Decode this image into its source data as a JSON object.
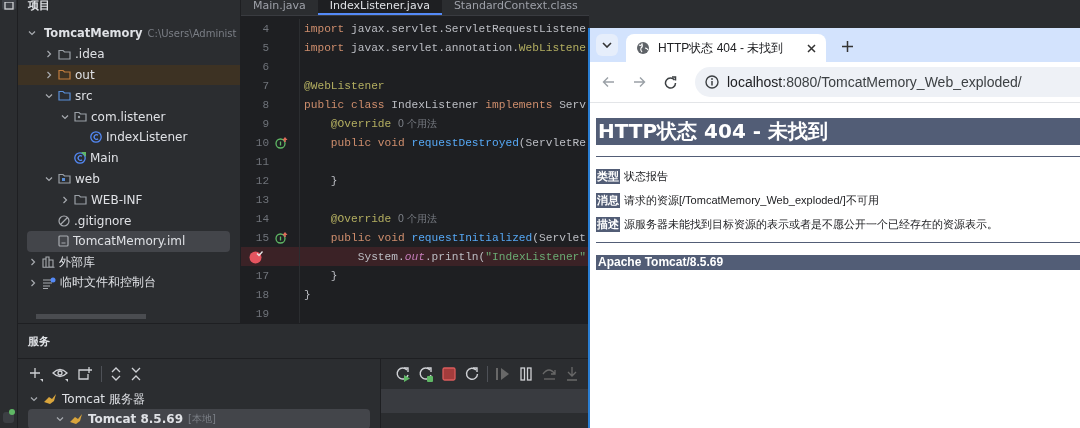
{
  "project_panel": {
    "title": "项目",
    "tree": [
      {
        "name": "TomcatMemory",
        "path": "C:\\Users\\Administ",
        "kind": "module",
        "expanded": true,
        "selected": false,
        "children": [
          {
            "name": ".idea",
            "kind": "folder",
            "expanded": false,
            "selected": false
          },
          {
            "name": "out",
            "kind": "excluded-folder",
            "expanded": false,
            "selected": false
          },
          {
            "name": "src",
            "kind": "source-folder",
            "expanded": true,
            "selected": false,
            "children": [
              {
                "name": "com.listener",
                "kind": "package",
                "expanded": true,
                "selected": false,
                "children": [
                  {
                    "name": "IndexListener",
                    "kind": "class",
                    "selected": false
                  }
                ]
              },
              {
                "name": "Main",
                "kind": "main-class",
                "selected": false
              }
            ]
          },
          {
            "name": "web",
            "kind": "web-folder",
            "expanded": true,
            "selected": false,
            "children": [
              {
                "name": "WEB-INF",
                "kind": "folder",
                "expanded": false,
                "selected": false
              }
            ]
          },
          {
            "name": ".gitignore",
            "kind": "ignore-file",
            "selected": false
          },
          {
            "name": "TomcatMemory.iml",
            "kind": "module-file",
            "selected": true
          }
        ]
      },
      {
        "name": "外部库",
        "kind": "library",
        "expanded": false,
        "selected": false
      },
      {
        "name": "临时文件和控制台",
        "kind": "scratch",
        "expanded": false,
        "selected": false
      }
    ]
  },
  "editor": {
    "tabs": [
      {
        "label": "Main.java",
        "selected": false
      },
      {
        "label": "IndexListener.java",
        "selected": true
      },
      {
        "label": "StandardContext.class",
        "selected": false
      }
    ],
    "lines": [
      {
        "number": "4",
        "override": false,
        "breakpoint": false,
        "tokens": [
          {
            "kind": "keyword",
            "text": "import"
          },
          {
            "kind": "plain",
            "text": " javax.servlet.ServletRequestListene"
          }
        ]
      },
      {
        "number": "5",
        "override": false,
        "breakpoint": false,
        "tokens": [
          {
            "kind": "keyword",
            "text": "import"
          },
          {
            "kind": "plain",
            "text": " javax.servlet.annotation."
          },
          {
            "kind": "annotation",
            "text": "WebListene"
          }
        ]
      },
      {
        "number": "6",
        "override": false,
        "breakpoint": false
      },
      {
        "number": "7",
        "override": false,
        "breakpoint": false,
        "tokens": [
          {
            "kind": "annotation",
            "text": "@WebListener"
          }
        ]
      },
      {
        "number": "8",
        "override": false,
        "breakpoint": false,
        "tokens": [
          {
            "kind": "keyword",
            "text": "public class"
          },
          {
            "kind": "plain",
            "text": " IndexListener "
          },
          {
            "kind": "keyword",
            "text": "implements"
          },
          {
            "kind": "plain",
            "text": " Serv"
          }
        ]
      },
      {
        "number": "9",
        "override": false,
        "breakpoint": false,
        "tokens": [
          {
            "kind": "annotation",
            "text": "    @Override"
          },
          {
            "kind": "hint",
            "text": "  0 个用法"
          }
        ]
      },
      {
        "number": "10",
        "override": true,
        "breakpoint": false,
        "tokens": [
          {
            "kind": "keyword",
            "text": "    public void"
          },
          {
            "kind": "function",
            "text": " requestDestroyed"
          },
          {
            "kind": "plain",
            "text": "(ServletRe"
          }
        ]
      },
      {
        "number": "11",
        "override": false,
        "breakpoint": false
      },
      {
        "number": "12",
        "override": false,
        "breakpoint": false,
        "tokens": [
          {
            "kind": "plain",
            "text": "    }"
          }
        ]
      },
      {
        "number": "13",
        "override": false,
        "breakpoint": false
      },
      {
        "number": "14",
        "override": false,
        "breakpoint": false,
        "tokens": [
          {
            "kind": "annotation",
            "text": "    @Override"
          },
          {
            "kind": "hint",
            "text": "  0 个用法"
          }
        ]
      },
      {
        "number": "15",
        "override": true,
        "breakpoint": false,
        "tokens": [
          {
            "kind": "keyword",
            "text": "    public void"
          },
          {
            "kind": "function",
            "text": " requestInitialized"
          },
          {
            "kind": "plain",
            "text": "(Servlet"
          }
        ]
      },
      {
        "override": false,
        "breakpoint": true,
        "tokens": [
          {
            "kind": "plain",
            "text": "        System."
          },
          {
            "kind": "field",
            "text": "out"
          },
          {
            "kind": "plain",
            "text": ".println("
          },
          {
            "kind": "string",
            "text": "\"IndexListener\""
          }
        ]
      },
      {
        "number": "17",
        "override": false,
        "breakpoint": false,
        "tokens": [
          {
            "kind": "plain",
            "text": "    }"
          }
        ]
      },
      {
        "number": "18",
        "override": false,
        "breakpoint": false,
        "tokens": [
          {
            "kind": "plain",
            "text": "}"
          }
        ]
      },
      {
        "number": "19",
        "override": false,
        "breakpoint": false
      }
    ]
  },
  "services": {
    "title": "服务",
    "run_toolbar": [
      {
        "disabled": false
      },
      {
        "disabled": false
      },
      {
        "disabled": false
      },
      {
        "disabled": false
      },
      {
        "disabled": true
      },
      {
        "disabled": false
      },
      {
        "disabled": true
      },
      {
        "disabled": true
      }
    ],
    "tree": [
      {
        "name": "Tomcat 服务器",
        "expanded": true,
        "selected": false,
        "children": [
          {
            "name": "Tomcat 8.5.69",
            "note": "[本地]",
            "expanded": true,
            "selected": true
          }
        ]
      }
    ]
  },
  "browser": {
    "tabs": [
      {
        "title": "HTTP状态 404 - 未找到",
        "selected": true
      }
    ],
    "address": {
      "host": "localhost",
      "path": ":8080/TomcatMemory_Web_exploded/"
    },
    "page": {
      "heading": "HTTP状态 404 - 未找到",
      "rows": [
        {
          "label": "类型",
          "text": "状态报告"
        },
        {
          "label": "消息",
          "text": "请求的资源[/TomcatMemory_Web_exploded/]不可用"
        },
        {
          "label": "描述",
          "text": "源服务器未能找到目标资源的表示或者是不愿公开一个已经存在的资源表示。"
        }
      ],
      "footer": "Apache Tomcat/8.5.69"
    }
  }
}
